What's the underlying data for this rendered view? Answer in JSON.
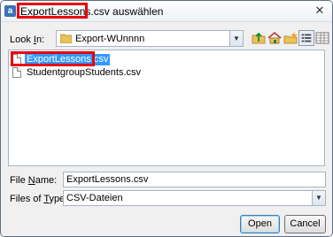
{
  "window": {
    "title_highlighted": "ExportLessons.csv",
    "title_suffix": " auswählen",
    "close_symbol": "✕",
    "app_icon_letter": "a"
  },
  "toolbar": {
    "look_in_label_prefix": "Look ",
    "look_in_label_accel": "I",
    "look_in_label_suffix": "n:",
    "look_in_value": "Export-WUnnnn",
    "icons": [
      "folder-up-icon",
      "home-icon",
      "new-folder-icon",
      "list-view-icon",
      "details-view-icon"
    ]
  },
  "files": [
    {
      "name": "ExportLessons.csv",
      "selected": true
    },
    {
      "name": "StudentgroupStudents.csv",
      "selected": false
    }
  ],
  "form": {
    "file_name_label_prefix": "File ",
    "file_name_label_accel": "N",
    "file_name_label_suffix": "ame:",
    "file_name_value": "ExportLessons.csv",
    "file_type_label_prefix": "Files of ",
    "file_type_label_accel": "T",
    "file_type_label_suffix": "ype:",
    "file_type_value": "CSV-Dateien"
  },
  "buttons": {
    "open": "Open",
    "cancel": "Cancel"
  },
  "colors": {
    "highlight_border": "#e8000f",
    "selection": "#3399ff"
  }
}
